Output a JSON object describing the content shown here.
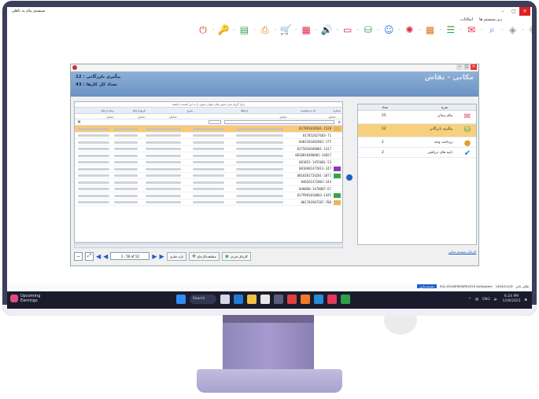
{
  "window": {
    "app_title": "سیستم پیام یه تاطی",
    "menu": [
      "زیر سیستم ها",
      "امکانات"
    ]
  },
  "toolbar": {
    "icons": [
      {
        "name": "power-icon",
        "glyph": "⏻",
        "color": "#e0401a"
      },
      {
        "name": "key-icon",
        "glyph": "🔑",
        "color": "#e07a1a"
      },
      {
        "name": "document-icon",
        "glyph": "▤",
        "color": "#3aa34c"
      },
      {
        "name": "printer-icon",
        "glyph": "⎙",
        "color": "#e07a1a"
      },
      {
        "name": "cart-icon",
        "glyph": "🛒",
        "color": "#3aa34c"
      },
      {
        "name": "calendar-icon",
        "glyph": "▦",
        "color": "#e02a4a"
      },
      {
        "name": "speaker-icon",
        "glyph": "🔊",
        "color": "#e07a1a"
      },
      {
        "name": "screen-icon",
        "glyph": "▭",
        "color": "#e02a4a"
      },
      {
        "name": "bag-icon",
        "glyph": "⛁",
        "color": "#3aa34c"
      },
      {
        "name": "person-icon",
        "glyph": "☺",
        "color": "#2a7ae0"
      },
      {
        "name": "network-icon",
        "glyph": "✺",
        "color": "#e02a4a"
      },
      {
        "name": "grid-icon",
        "glyph": "▦",
        "color": "#e07a1a"
      },
      {
        "name": "list-icon",
        "glyph": "☰",
        "color": "#3aa34c"
      },
      {
        "name": "chat-icon",
        "glyph": "✉",
        "color": "#e02a4a"
      },
      {
        "name": "monitor-search-icon",
        "glyph": "⌕",
        "color": "#2a7ae0"
      },
      {
        "name": "box-icon",
        "glyph": "◈",
        "color": "#999999"
      },
      {
        "name": "users-icon",
        "glyph": "⚇",
        "color": "#3aa34c"
      },
      {
        "name": "file-icon",
        "glyph": "▤",
        "color": "#e02a4a"
      },
      {
        "name": "info-icon",
        "glyph": "ⓘ",
        "color": "#e02a4a"
      }
    ]
  },
  "appwin": {
    "title": "کارتابل",
    "header_title": "مکانی - نقاش",
    "line1": "پیگیری بازرگانی : 12",
    "line2": "تعداد کل کارها : 43"
  },
  "grid": {
    "hint": "برای گروه بندی ستون های عنوان ستون را به این قسمت بکشید",
    "columns": [
      "شماره",
      "کد درخواست",
      "ارتباط",
      "شرح",
      "تاریخ ارجاع",
      "زمان ارجاع"
    ],
    "filter_label": "شامل:",
    "rows": [
      {
        "id": "017891010501-1528",
        "swatch": "#e6b65a",
        "selected": true
      },
      {
        "id": "017852027603-71",
        "swatch": "",
        "selected": false
      },
      {
        "id": "0401201602001-175",
        "swatch": "",
        "selected": false
      },
      {
        "id": "0175010180801-1417",
        "swatch": "",
        "selected": false
      },
      {
        "id": "0010010480801-24027",
        "swatch": "",
        "selected": false
      },
      {
        "id": "001052-1455001-53",
        "swatch": "",
        "selected": false
      },
      {
        "id": "0010401472013-247",
        "swatch": "#8e3ab4",
        "selected": false
      },
      {
        "id": "0010201720201-2077",
        "swatch": "#3aa34c",
        "selected": false
      },
      {
        "id": "040261472001-244",
        "swatch": "",
        "selected": false
      },
      {
        "id": "040080-1470007-67",
        "swatch": "",
        "selected": false
      },
      {
        "id": "0179981010003-1445",
        "swatch": "#3aa34c",
        "selected": false
      },
      {
        "id": "001701907207-788",
        "swatch": "#e6b65a",
        "selected": false
      }
    ]
  },
  "pager": {
    "range": "1 - 50 of 12",
    "refresh": "تازه سازی",
    "view": "مشاهده/ارجاع",
    "close": "کارتابل فردی"
  },
  "rpanel": {
    "col_title": "شرح",
    "col_count": "تعداد",
    "items": [
      {
        "label": "پیام رسان",
        "count": "25",
        "icon": "mail-icon",
        "selected": false
      },
      {
        "label": "پیگیری بازرگانی",
        "count": "12",
        "icon": "bag-icon",
        "selected": true
      },
      {
        "label": "پرداخت وجه",
        "count": "1",
        "icon": "coin-icon",
        "selected": false
      },
      {
        "label": "تایید های دریافتی",
        "count": "2",
        "icon": "approval-icon",
        "selected": false
      }
    ],
    "link": "کارتابل سیستم محلی"
  },
  "status": {
    "left": "ملکی تاجر",
    "date": "1403/11/10",
    "server": "SQL:GOLSERV\\SRV2019 Gol5ystem",
    "badge": "مستندسازی"
  },
  "taskbar": {
    "weather_title": "Upcoming",
    "weather_sub": "Earnings",
    "search": "Search",
    "lang": "ENG",
    "time": "6:24 PM",
    "date": "1/29/2025"
  }
}
